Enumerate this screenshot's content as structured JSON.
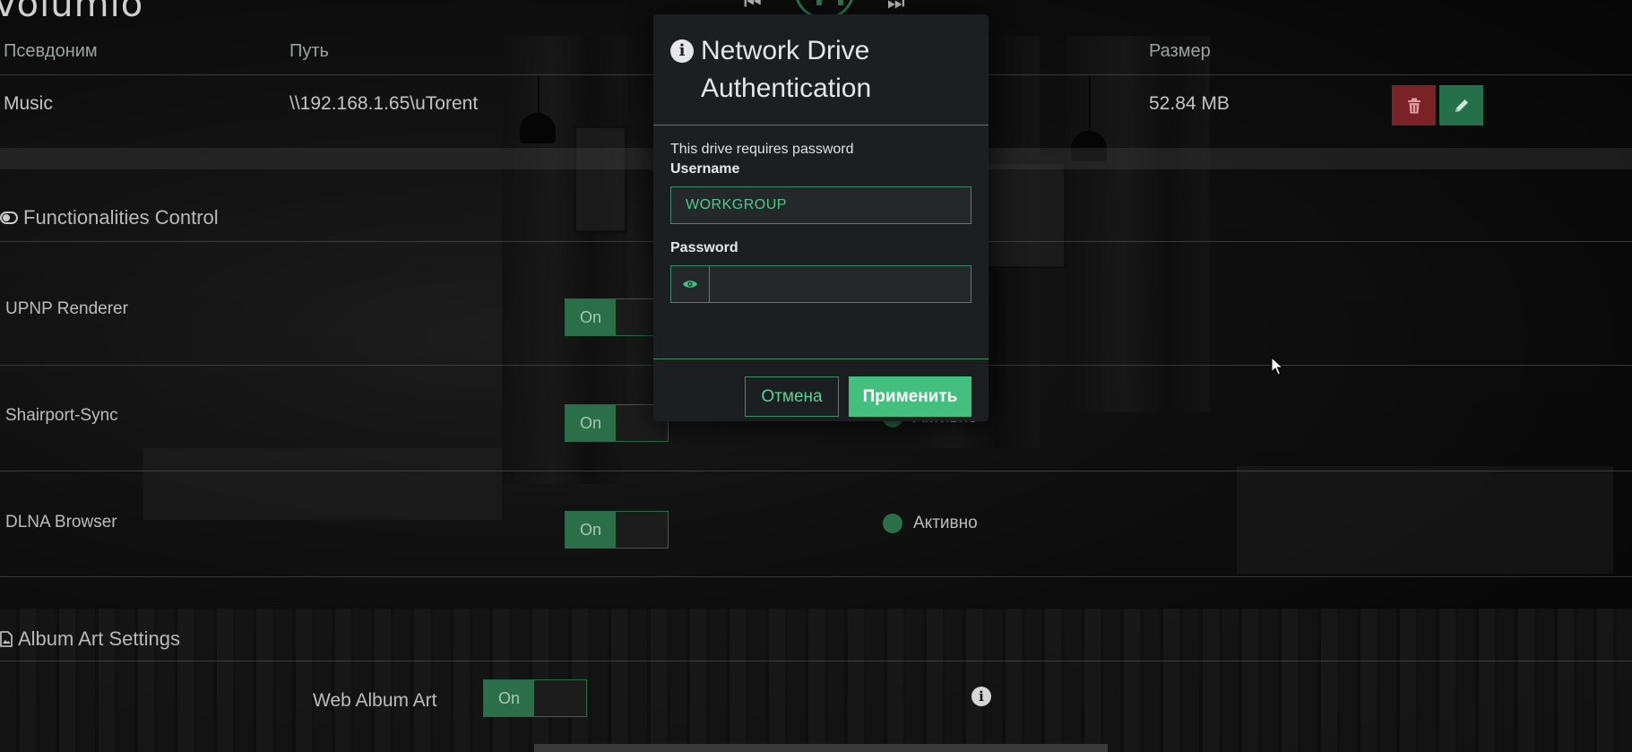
{
  "app": {
    "logo_text": "volumio"
  },
  "player": {
    "prev_icon": "skip-previous-icon",
    "play_icon": "pause-icon",
    "next_icon": "skip-next-icon"
  },
  "drives_table": {
    "headers": {
      "alias": "Псевдоним",
      "path": "Путь",
      "size": "Размер"
    },
    "rows": [
      {
        "alias": "Music",
        "path": "\\\\192.168.1.65\\uTorent",
        "size": "52.84 MB"
      }
    ],
    "delete_icon": "trash-icon",
    "edit_icon": "pencil-icon"
  },
  "functionalities": {
    "title": "Functionalities Control",
    "icon": "toggle-icon",
    "items": [
      {
        "label": "UPNP Renderer",
        "toggle": "On",
        "status": ""
      },
      {
        "label": "Shairport-Sync",
        "toggle": "On",
        "status": "Активно"
      },
      {
        "label": "DLNA Browser",
        "toggle": "On",
        "status": "Активно"
      }
    ]
  },
  "album_art": {
    "title": "Album Art Settings",
    "icon": "image-file-icon",
    "web_album_art_label": "Web Album Art",
    "web_album_art_toggle": "On"
  },
  "modal": {
    "title": "Network Drive Authentication",
    "title_icon": "info-icon",
    "message": "This drive requires password",
    "username_label": "Username",
    "username_value": "WORKGROUP",
    "password_label": "Password",
    "password_value": "",
    "show_password_icon": "eye-icon",
    "cancel_label": "Отмена",
    "apply_label": "Применить"
  },
  "colors": {
    "accent": "#43c07d",
    "accent_dark": "#2a6f48",
    "danger": "#7a2226",
    "modal_bg": "#1c1f21"
  }
}
